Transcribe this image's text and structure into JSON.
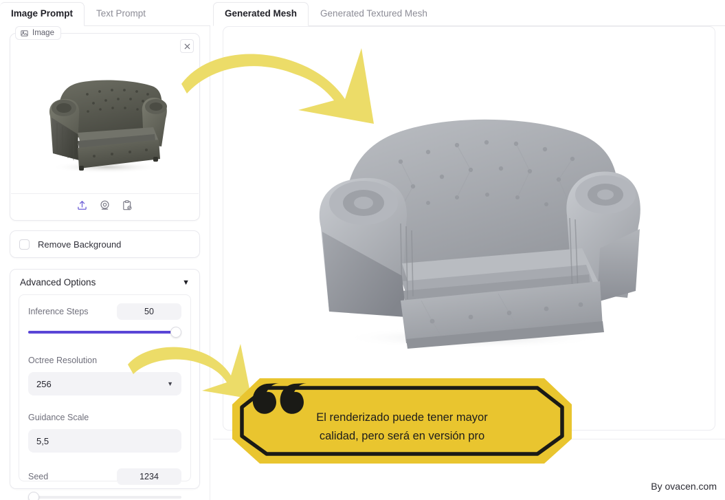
{
  "left_tabs": [
    {
      "label": "Image Prompt",
      "active": true
    },
    {
      "label": "Text Prompt",
      "active": false
    }
  ],
  "right_tabs": [
    {
      "label": "Generated Mesh",
      "active": true
    },
    {
      "label": "Generated Textured Mesh",
      "active": false
    }
  ],
  "image_card": {
    "badge_label": "Image",
    "badge_icon": "image-icon",
    "close_icon": "close-icon",
    "preview_alt": "dark olive leather chesterfield armchair photo",
    "tools": [
      {
        "name": "upload-icon",
        "label": "Upload"
      },
      {
        "name": "webcam-icon",
        "label": "Webcam"
      },
      {
        "name": "paste-clipboard-icon",
        "label": "Paste from clipboard"
      }
    ]
  },
  "remove_background": {
    "label": "Remove Background",
    "checked": false
  },
  "advanced_options": {
    "title": "Advanced Options",
    "chevron": "▼",
    "expanded": true,
    "fields": {
      "inference_steps": {
        "label": "Inference Steps",
        "value": "50",
        "slider_percent": 100
      },
      "octree_resolution": {
        "label": "Octree Resolution",
        "value": "256",
        "caret": "▼"
      },
      "guidance_scale": {
        "label": "Guidance Scale",
        "value": "5,5"
      },
      "seed": {
        "label": "Seed",
        "value": "1234",
        "slider_percent": 0
      }
    }
  },
  "mesh_viewer": {
    "alt": "grey 3D mesh of chesterfield armchair"
  },
  "annotations": {
    "quote": {
      "line1": "El renderizado puede tener mayor",
      "line2": "calidad, pero será en versión pro",
      "quote_mark": "“"
    },
    "arrow_top": "curved-yellow-arrow-to-mesh",
    "arrow_bottom": "curved-yellow-arrow-to-quote"
  },
  "watermark": {
    "text": "By ovacen.com"
  },
  "colors": {
    "accent_purple": "#5a45d6",
    "arrow_yellow": "#ecdc68",
    "bubble_yellow": "#e9c52f",
    "bubble_outline": "#1a1a16",
    "panel_border": "#ececf0",
    "field_bg": "#f3f3f6"
  }
}
